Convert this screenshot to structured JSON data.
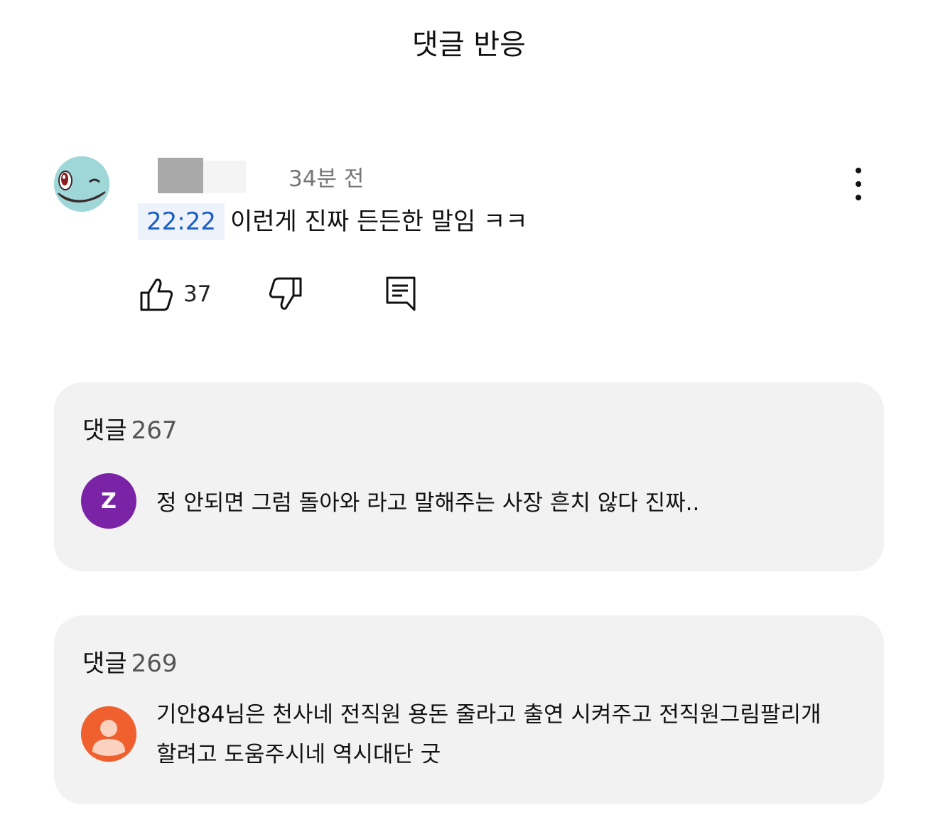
{
  "page": {
    "title": "댓글 반응"
  },
  "top_comment": {
    "avatar": "squirtle-avatar",
    "time_ago": "34분 전",
    "timestamp": "22:22",
    "text": "이런게 진짜 든든한 말임 ㅋㅋ",
    "like_count": "37",
    "icons": [
      "thumbs-up-icon",
      "thumbs-down-icon",
      "reply-icon",
      "more-vert-icon"
    ]
  },
  "cards": [
    {
      "label": "댓글",
      "count": "267",
      "avatar_letter": "Z",
      "avatar_color": "#7b23a6",
      "text": "정 안되면 그럼 돌아와 라고 말해주는 사장 흔치 않다 진짜.."
    },
    {
      "label": "댓글",
      "count": "269",
      "avatar_color": "#f0602e",
      "text_line1": "기안84님은 천사네  전직원 용돈 줄라고 출연 시켜주고 전직원그림팔리개",
      "text_line2": "할려고 도움주시네 역시대단 굿"
    }
  ]
}
